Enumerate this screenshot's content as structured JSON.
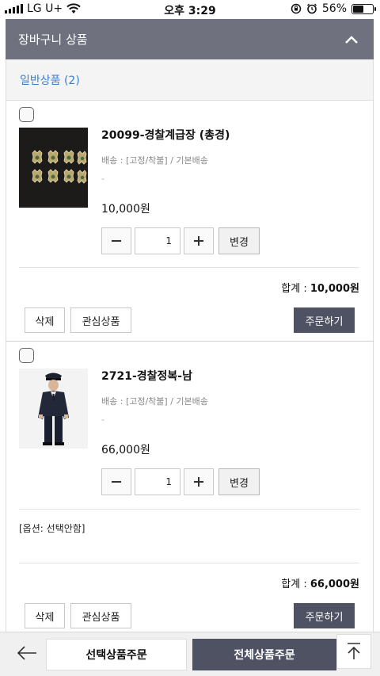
{
  "status_bar": {
    "carrier": "LG U+",
    "time": "오후 3:29",
    "battery_text": "56%",
    "battery_level": 0.56
  },
  "header": {
    "title": "장바구니 상품"
  },
  "section": {
    "title": "일반상품 (2)"
  },
  "items": [
    {
      "name": "20099-경찰계급장 (총경)",
      "shipping": "배송 : [고정/착불] / 기본배송",
      "dash": "-",
      "price": "10,000원",
      "quantity": "1",
      "change_label": "변경",
      "total_label": "합계 : ",
      "total_value": "10,000원",
      "delete_label": "삭제",
      "wishlist_label": "관심상품",
      "order_label": "주문하기"
    },
    {
      "name": "2721-경찰정복-남",
      "shipping": "배송 : [고정/착불] / 기본배송",
      "dash": "-",
      "price": "66,000원",
      "quantity": "1",
      "change_label": "변경",
      "option": "[옵션: 선택안함]",
      "total_label": "합계 : ",
      "total_value": "66,000원",
      "delete_label": "삭제",
      "wishlist_label": "관심상품",
      "order_label": "주문하기"
    }
  ],
  "bottom_bar": {
    "order_selected_label": "선택상품주문",
    "order_all_label": "전체상품주문"
  },
  "colors": {
    "header_bg": "#6f717e",
    "accent_blue": "#3b7fcf",
    "dark_button": "#4f5262"
  }
}
